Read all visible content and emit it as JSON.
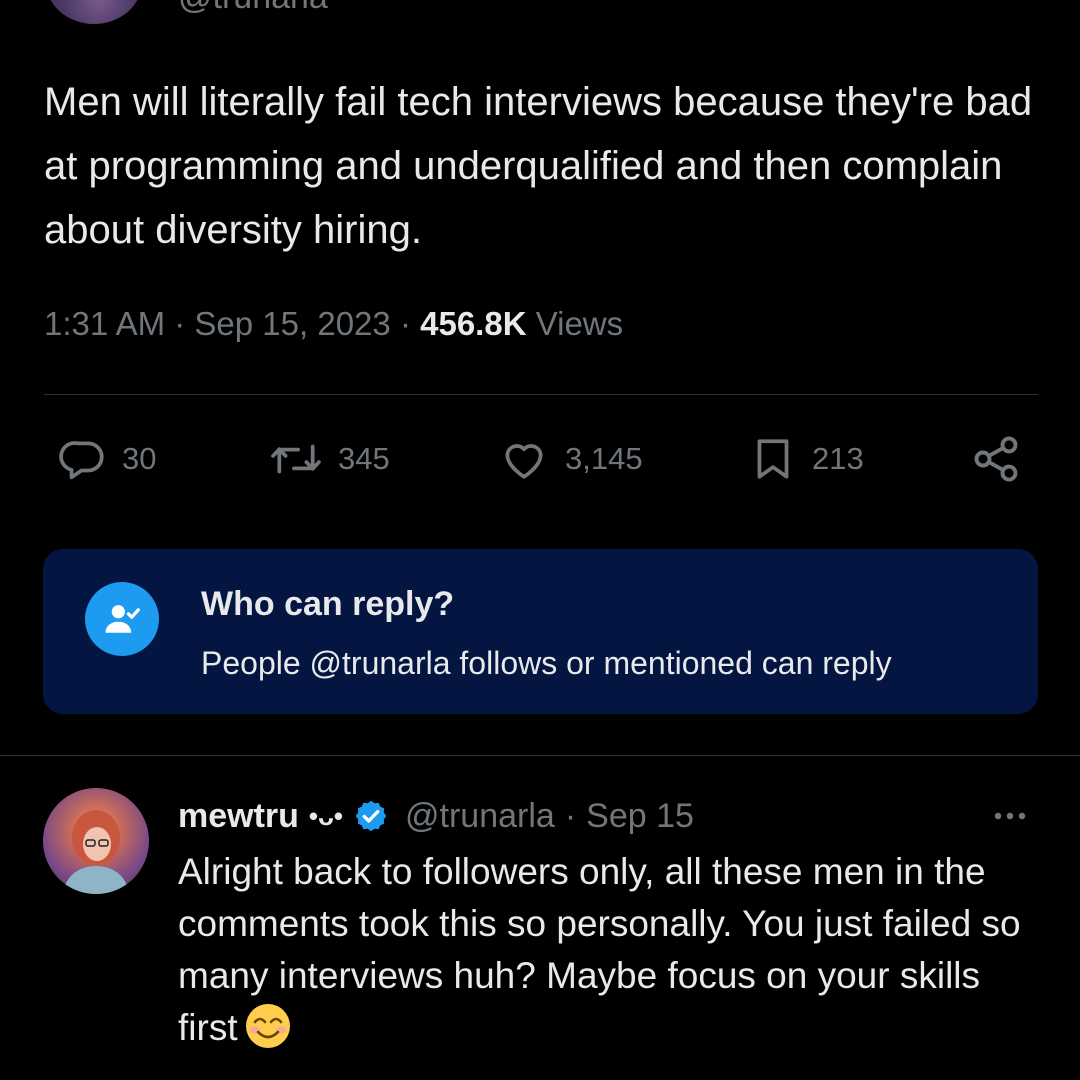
{
  "tweet": {
    "handle": "@trunarla",
    "text": "Men will literally fail tech interviews because they're bad at programming and underqualified and then complain about diversity hiring.",
    "time": "1:31 AM",
    "date": "Sep 15, 2023",
    "views_count": "456.8K",
    "views_label": "Views",
    "separator": "·",
    "actions": {
      "replies": "30",
      "reposts": "345",
      "likes": "3,145",
      "bookmarks": "213"
    }
  },
  "reply_restriction": {
    "title": "Who can reply?",
    "subtitle": "People @trunarla follows or mentioned can reply"
  },
  "reply": {
    "name": "mewtru",
    "name_decoration": "•ᴗ•",
    "handle": "@trunarla",
    "separator": "·",
    "date": "Sep 15",
    "text": "Alright back to followers only, all these men in the comments took this so personally. You just failed so many interviews huh? Maybe focus on your skills first",
    "emoji": "smiling-face-with-smiling-eyes"
  },
  "colors": {
    "background": "#000000",
    "text": "#e7e9ea",
    "muted": "#71767b",
    "accent": "#1d9bf0",
    "reply_box": "#031540"
  },
  "icons": [
    "reply-icon",
    "repost-icon",
    "heart-icon",
    "bookmark-icon",
    "share-icon",
    "person-check-icon",
    "verified-badge-icon",
    "more-icon"
  ]
}
